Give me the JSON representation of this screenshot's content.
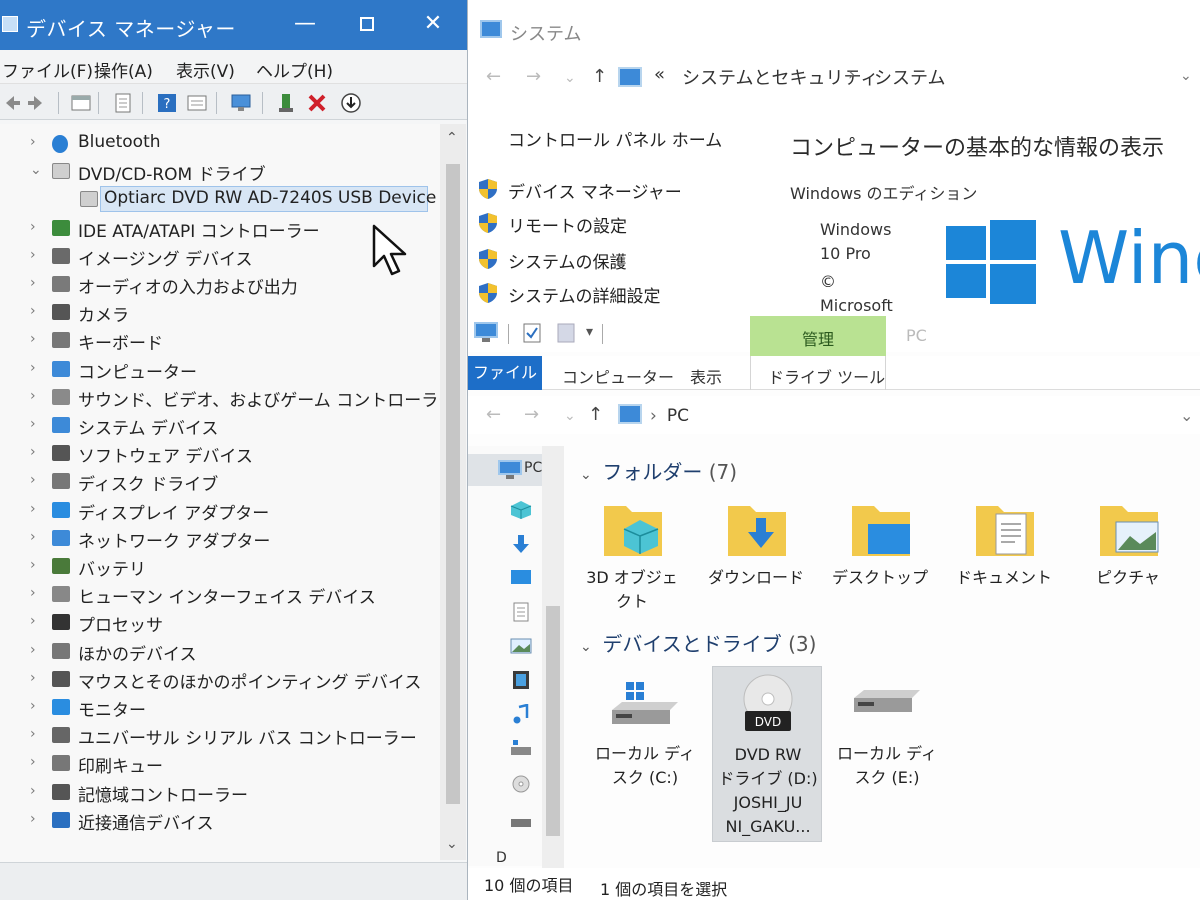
{
  "device_manager": {
    "title": "デバイス マネージャー",
    "menu": [
      "ファイル(F)",
      "操作(A)",
      "表示(V)",
      "ヘルプ(H)"
    ],
    "tree": [
      {
        "label": "Bluetooth",
        "expanded": false,
        "icon": "bluetooth-icon"
      },
      {
        "label": "DVD/CD-ROM ドライブ",
        "expanded": true,
        "icon": "dvd-drive-icon"
      },
      {
        "label": "Optiarc DVD RW AD-7240S USB Device",
        "child": true,
        "selected": true,
        "icon": "dvd-drive-icon"
      },
      {
        "label": "IDE ATA/ATAPI コントローラー",
        "icon": "ide-controller-icon"
      },
      {
        "label": "イメージング デバイス",
        "icon": "camera-icon"
      },
      {
        "label": "オーディオの入力および出力",
        "icon": "speaker-icon"
      },
      {
        "label": "カメラ",
        "icon": "webcam-icon"
      },
      {
        "label": "キーボード",
        "icon": "keyboard-icon"
      },
      {
        "label": "コンピューター",
        "icon": "computer-icon"
      },
      {
        "label": "サウンド、ビデオ、およびゲーム コントローラー",
        "icon": "sound-icon"
      },
      {
        "label": "システム デバイス",
        "icon": "system-device-icon"
      },
      {
        "label": "ソフトウェア デバイス",
        "icon": "software-device-icon"
      },
      {
        "label": "ディスク ドライブ",
        "icon": "disk-drive-icon"
      },
      {
        "label": "ディスプレイ アダプター",
        "icon": "display-adapter-icon"
      },
      {
        "label": "ネットワーク アダプター",
        "icon": "network-adapter-icon"
      },
      {
        "label": "バッテリ",
        "icon": "battery-icon"
      },
      {
        "label": "ヒューマン インターフェイス デバイス",
        "icon": "hid-icon"
      },
      {
        "label": "プロセッサ",
        "icon": "processor-icon"
      },
      {
        "label": "ほかのデバイス",
        "icon": "other-device-icon"
      },
      {
        "label": "マウスとそのほかのポインティング デバイス",
        "icon": "mouse-icon"
      },
      {
        "label": "モニター",
        "icon": "monitor-icon"
      },
      {
        "label": "ユニバーサル シリアル バス コントローラー",
        "icon": "usb-icon"
      },
      {
        "label": "印刷キュー",
        "icon": "printer-icon"
      },
      {
        "label": "記憶域コントローラー",
        "icon": "storage-controller-icon"
      },
      {
        "label": "近接通信デバイス",
        "icon": "proximity-device-icon"
      }
    ]
  },
  "system": {
    "title": "システム",
    "breadcrumb": [
      "«",
      "システムとセキュリティ",
      "›",
      "システム"
    ],
    "home": "コントロール パネル ホーム",
    "links": [
      "デバイス マネージャー",
      "リモートの設定",
      "システムの保護",
      "システムの詳細設定"
    ],
    "heading": "コンピューターの基本的な情報の表示",
    "edition_label": "Windows のエディション",
    "edition_line1": "Windows",
    "edition_line2": "10 Pro",
    "copyright": "©",
    "microsoft": "Microsoft",
    "logo_text": "Winc"
  },
  "explorer": {
    "context_tab": "管理",
    "pc_tab": "PC",
    "ribbon_tabs": [
      "ファイル",
      "コンピューター",
      "表示",
      "ドライブ ツール"
    ],
    "address": "PC",
    "nav_pc": "PC",
    "nav_d": "D",
    "folders_group": "フォルダー",
    "folders_count": "(7)",
    "folders": [
      {
        "line1": "3D オブジェ",
        "line2": "クト"
      },
      {
        "line1": "ダウンロード",
        "line2": ""
      },
      {
        "line1": "デスクトップ",
        "line2": ""
      },
      {
        "line1": "ドキュメント",
        "line2": ""
      },
      {
        "line1": "ピクチャ",
        "line2": ""
      }
    ],
    "drives_group": "デバイスとドライブ",
    "drives_count": "(3)",
    "dvd_badge": "DVD",
    "drives": [
      {
        "lines": [
          "ローカル ディ",
          "スク (C:)"
        ]
      },
      {
        "lines": [
          "DVD RW",
          "ドライブ (D:)",
          "JOSHI_JU",
          "NI_GAKU..."
        ]
      },
      {
        "lines": [
          "ローカル ディ",
          "スク (E:)"
        ]
      }
    ],
    "status_count": "10 個の項目",
    "status_selected": "1 個の項目を選択"
  },
  "colors": {
    "accent": "#2f78c8",
    "windows_blue": "#1c86d8",
    "manage_tab": "#b9e292",
    "folder": "#f2c94c"
  }
}
